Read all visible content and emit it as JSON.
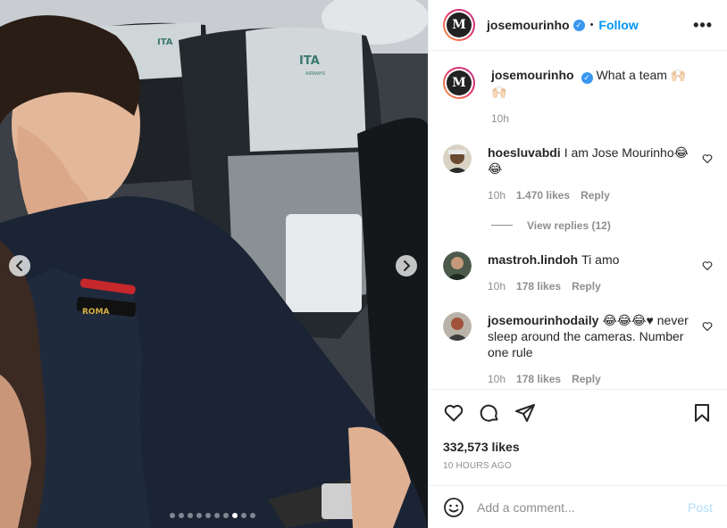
{
  "post": {
    "author": "josemourinho",
    "follow_label": "Follow",
    "separator": "•",
    "more_label": "•••",
    "avatar_letter": "M",
    "caption": "What a team 🙌🏻🙌🏻",
    "caption_time": "10h"
  },
  "media": {
    "seat_logo_text": "ITA",
    "seat_logo_sub": "AIRWAYS",
    "bracelet_text": "ROMA",
    "dots_total": 10,
    "dots_active": 8
  },
  "comments": [
    {
      "user": "hoesluvabdi",
      "text": "I am Jose Mourinho😂😂",
      "time": "10h",
      "likes": "1.470 likes",
      "reply_label": "Reply"
    },
    {
      "user": "mastroh.lindoh",
      "text": "Ti amo",
      "time": "10h",
      "likes": "178 likes",
      "reply_label": "Reply"
    },
    {
      "user": "josemourinhodaily",
      "text": "😂😂😂♥ never sleep around the cameras. Number one rule",
      "time": "10h",
      "likes": "178 likes",
      "reply_label": "Reply"
    }
  ],
  "view_replies": "View replies (12)",
  "likes_count": "332,573 likes",
  "posted_ago": "10 HOURS AGO",
  "add_comment": {
    "placeholder": "Add a comment...",
    "post_label": "Post"
  },
  "colors": {
    "accent": "#0095f6",
    "post_disabled": "#b2dffc",
    "muted": "#8e8e8e",
    "verified": "#3897f0"
  }
}
